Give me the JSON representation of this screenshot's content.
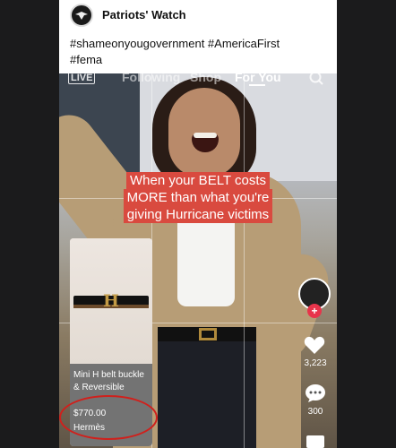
{
  "post": {
    "author": "Patriots' Watch",
    "caption_line1": "#shameonyougovernment #AmericaFirst",
    "caption_line2": "#fema"
  },
  "video": {
    "nav": {
      "live": "LIVE",
      "following": "Following",
      "shop": "Shop",
      "for_you": "For You"
    },
    "overlay": {
      "line1": "When your BELT costs",
      "line2": "MORE than what you're",
      "line3": "giving Hurricane victims"
    },
    "product": {
      "name_line1": "Mini H belt buckle",
      "name_line2": "& Reversible",
      "price": "$770.00",
      "brand": "Hermès"
    },
    "rail": {
      "plus": "+",
      "like_count": "3,223",
      "comment_count": "300"
    }
  },
  "colors": {
    "overlay_bg": "#d94a3f",
    "annotation_circle": "#d0201c",
    "follow_badge": "#e8344b"
  }
}
